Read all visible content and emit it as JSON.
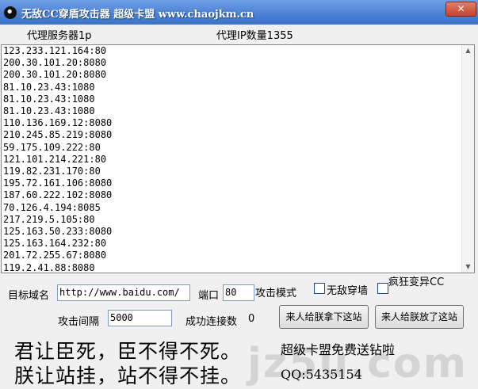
{
  "window": {
    "title": "无敌CC穿盾攻击器   超级卡盟  www.chaojkm.cn",
    "close_label": "✕"
  },
  "header": {
    "proxy_server_label": "代理服务器1p",
    "proxy_count_label": "代理IP数量1355"
  },
  "proxy_list": [
    "123.233.121.164:80",
    "200.30.101.20:8080",
    "200.30.101.20:8080",
    "81.10.23.43:1080",
    "81.10.23.43:1080",
    "81.10.23.43:1080",
    "110.136.169.12:8080",
    "210.245.85.219:8080",
    "59.175.109.222:80",
    "121.101.214.221:80",
    "119.82.231.170:80",
    "195.72.161.106:8080",
    "187.60.222.102:8080",
    "70.126.4.194:8085",
    "217.219.5.105:80",
    "125.163.50.233:8080",
    "125.163.164.232:80",
    "201.72.255.67:8080",
    "119.2.41.88:8080"
  ],
  "form": {
    "target_domain_label": "目标域名",
    "target_domain_value": "http://www.baidu.com/",
    "port_label": "端口",
    "port_value": "80",
    "attack_mode_label": "攻击模式",
    "option_invincible_wall": "无敌穿墙",
    "option_crazy_cc": "疯狂变异CC",
    "interval_label": "攻击间隔",
    "interval_value": "5000",
    "success_count_label": "成功连接数",
    "success_count_value": "0",
    "button_start": "来人给朕拿下这站",
    "button_stop": "来人给朕放了这站"
  },
  "footer": {
    "slogan_line1": "君让臣死，臣不得不死。",
    "slogan_line2": "朕让站挂，站不得不挂。",
    "promo_line1": "超级卡盟免费送钻啦",
    "promo_line2": "QQ:5435154",
    "watermark": "jz5u.com"
  }
}
